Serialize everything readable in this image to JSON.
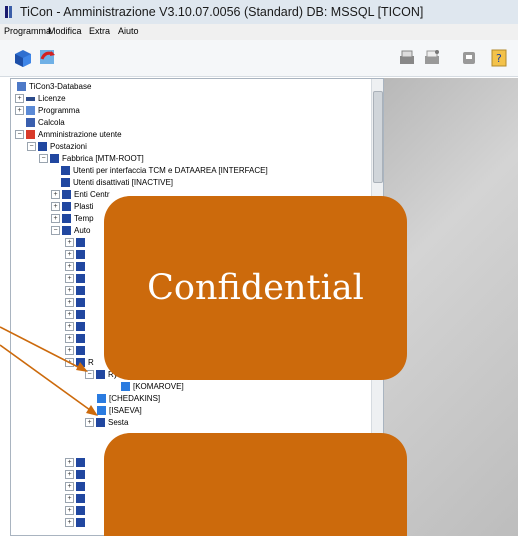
{
  "window": {
    "title": "TiCon - Amministrazione V3.10.07.0056 (Standard) DB: MSSQL [TICON]"
  },
  "menu": [
    "Programma",
    "Modifica",
    "Extra",
    "Aiuto"
  ],
  "toolbar": {
    "right_icons": [
      "print-icon",
      "print-preview-icon",
      "device-icon",
      "help-icon"
    ]
  },
  "tree": {
    "rows": [
      {
        "label": "TiCon3-Database",
        "icon": "database-icon"
      },
      {
        "label": "Licenze",
        "icon": "key-icon"
      },
      {
        "label": "Programma",
        "icon": "program-icon"
      },
      {
        "label": "Calcola",
        "icon": "calculator-icon"
      },
      {
        "label": "Amministrazione utente",
        "icon": "users-admin-icon"
      },
      {
        "label": "Postazioni",
        "icon": "folder-icon"
      },
      {
        "label": "Fabbrica [MTM-ROOT]",
        "icon": "folder-icon"
      },
      {
        "label": "Utenti per interfaccia TCM e DATAAREA [INTERFACE]",
        "icon": "folder-icon"
      },
      {
        "label": "Utenti disattivati [INACTIVE]",
        "icon": "folder-icon"
      },
      {
        "label": "Enti Centr",
        "icon": "folder-icon"
      },
      {
        "label": "Plasti",
        "icon": "folder-icon"
      },
      {
        "label": "Temp",
        "icon": "folder-icon"
      },
      {
        "label": "Auto",
        "icon": "folder-icon"
      },
      {
        "label": "R",
        "icon": "folder-icon"
      },
      {
        "label": "Ry",
        "icon": "folder-icon"
      },
      {
        "label": "[KOMAROVE]",
        "icon": "user-icon"
      },
      {
        "label": "[CHEDAKINS]",
        "icon": "user-icon"
      },
      {
        "label": "[ISAEVA]",
        "icon": "user-icon"
      },
      {
        "label": "Sesta",
        "icon": "folder-icon"
      }
    ]
  },
  "overlay": {
    "confidential_label": "Confidential"
  },
  "colors": {
    "redaction": "#cc6a0c",
    "arrow": "#cc6a0c"
  }
}
